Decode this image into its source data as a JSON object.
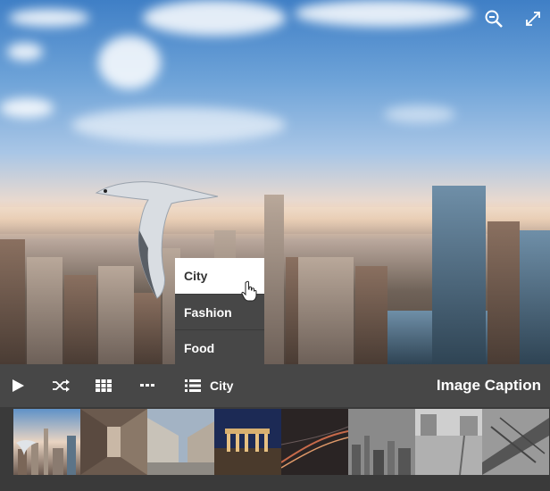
{
  "gallery": {
    "categories": [
      {
        "label": "City",
        "active": true
      },
      {
        "label": "Fashion",
        "active": false
      },
      {
        "label": "Food",
        "active": false
      }
    ],
    "toolbar": {
      "play_icon": "play-icon",
      "shuffle_icon": "shuffle-icon",
      "grid_icon": "grid-icon",
      "more_icon": "more-icon",
      "list_icon": "list-icon",
      "current_category": "City",
      "caption": "Image Caption"
    },
    "controls": {
      "zoom_icon": "zoom-out-icon",
      "fullscreen_icon": "fullscreen-icon"
    },
    "thumbnails": [
      {
        "name": "city-skyline-bird"
      },
      {
        "name": "architecture-corridor"
      },
      {
        "name": "street-plaza"
      },
      {
        "name": "brandenburg-gate-night"
      },
      {
        "name": "tunnel-lights"
      },
      {
        "name": "skyline-monochrome"
      },
      {
        "name": "plaza-monochrome"
      },
      {
        "name": "bridge-monochrome"
      }
    ],
    "colors": {
      "toolbar_bg": "#474747",
      "strip_bg": "#3a3a3a",
      "menu_active_bg": "#ffffff",
      "text": "#ffffff"
    }
  }
}
